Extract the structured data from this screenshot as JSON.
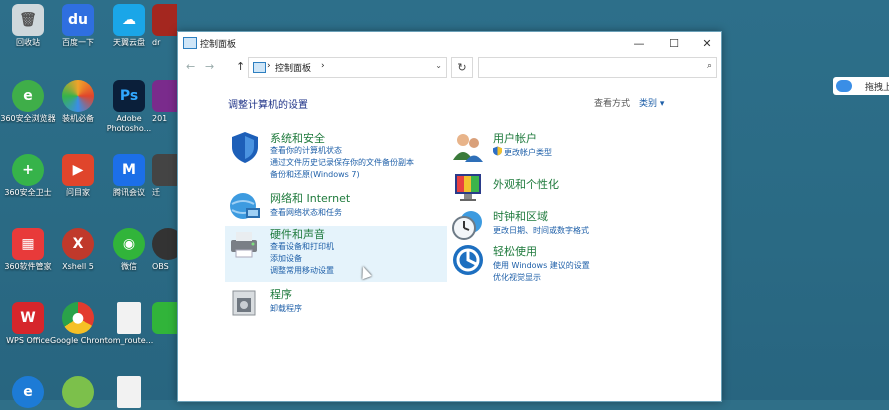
{
  "desktop": {
    "icons": [
      {
        "label": "回收站",
        "color": "#cfd8dc"
      },
      {
        "label": "百度一下",
        "color": "#2f6fe0"
      },
      {
        "label": "天翼云盘",
        "color": "#1aa6e8"
      },
      {
        "label": "dr",
        "color": "#a4271f"
      },
      {
        "label": "360安全浏览器",
        "color": "#3fae49"
      },
      {
        "label": "装机必备",
        "color": "#f0a32a"
      },
      {
        "label": "Adobe Photosho...",
        "color": "#0a1f3a"
      },
      {
        "label": "201",
        "color": "#7a2b8c"
      },
      {
        "label": "360安全卫士",
        "color": "#36b34a"
      },
      {
        "label": "问目家",
        "color": "#e0452b"
      },
      {
        "label": "腾讯会议",
        "color": "#1c6fe8"
      },
      {
        "label": "迁",
        "color": "#444444"
      },
      {
        "label": "360软件管家",
        "color": "#e83a3a"
      },
      {
        "label": "Xshell 5",
        "color": "#c0392b"
      },
      {
        "label": "微信",
        "color": "#31b43a"
      },
      {
        "label": "OBS",
        "color": "#333333"
      },
      {
        "label": "WPS Office",
        "color": "#d6262b"
      },
      {
        "label": "Google Chrome",
        "color": "#e8a21b"
      },
      {
        "label": "tom_route...",
        "color": "#f2f2f2"
      },
      {
        "label": "",
        "color": "#31b43a"
      },
      {
        "label": "",
        "color": "#1d7bd6"
      },
      {
        "label": "",
        "color": "#7cc04b"
      },
      {
        "label": "",
        "color": "#f2f2f2"
      },
      {
        "label": "",
        "color": "#31b43a"
      }
    ],
    "cloud_widget": {
      "label": "拖拽上"
    }
  },
  "window": {
    "title": "控制面板",
    "controls": {
      "minimize": "—",
      "maximize": "☐",
      "close": "✕"
    },
    "address": {
      "back": "←",
      "forward": "→",
      "up": "↑",
      "sep": "›",
      "path": "控制面板",
      "path_sep": "›",
      "dropdown": "⌄",
      "refresh": "↻"
    },
    "search": {
      "value": "",
      "placeholder": "",
      "icon": "⌕"
    },
    "heading": "调整计算机的设置",
    "view_by_label": "查看方式",
    "view_by_value": "类别 ▾",
    "categories": [
      {
        "title": "系统和安全",
        "links": [
          "查看你的计算机状态",
          "通过文件历史记录保存你的文件备份副本",
          "备份和还原(Windows 7)"
        ]
      },
      {
        "title": "网络和 Internet",
        "links": [
          "查看网络状态和任务"
        ]
      },
      {
        "title": "硬件和声音",
        "links": [
          "查看设备和打印机",
          "添加设备",
          "调整常用移动设置"
        ]
      },
      {
        "title": "程序",
        "links": [
          "卸载程序"
        ]
      },
      {
        "title": "用户帐户",
        "links": [
          "更改帐户类型"
        ]
      },
      {
        "title": "外观和个性化",
        "links": []
      },
      {
        "title": "时钟和区域",
        "links": [
          "更改日期、时间或数字格式"
        ]
      },
      {
        "title": "轻松使用",
        "links": [
          "使用 Windows 建议的设置",
          "优化视觉显示"
        ]
      }
    ]
  }
}
